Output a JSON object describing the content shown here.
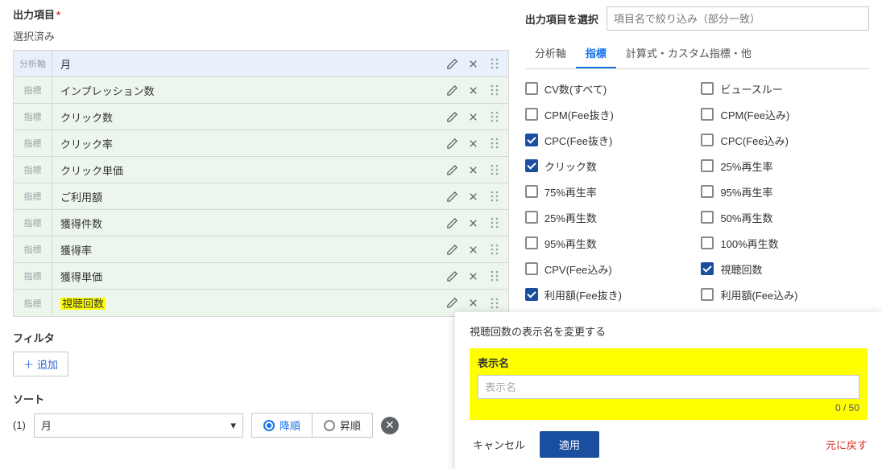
{
  "section_title": "出力項目",
  "selected_label": "選択済み",
  "axis_tag": "分析軸",
  "metric_tag": "指標",
  "rows": [
    {
      "tag": "分析軸",
      "label": "月",
      "type": "axis"
    },
    {
      "tag": "指標",
      "label": "インプレッション数",
      "type": "metric"
    },
    {
      "tag": "指標",
      "label": "クリック数",
      "type": "metric"
    },
    {
      "tag": "指標",
      "label": "クリック率",
      "type": "metric"
    },
    {
      "tag": "指標",
      "label": "クリック単価",
      "type": "metric"
    },
    {
      "tag": "指標",
      "label": "ご利用額",
      "type": "metric"
    },
    {
      "tag": "指標",
      "label": "獲得件数",
      "type": "metric"
    },
    {
      "tag": "指標",
      "label": "獲得率",
      "type": "metric"
    },
    {
      "tag": "指標",
      "label": "獲得単価",
      "type": "metric"
    },
    {
      "tag": "指標",
      "label": "視聴回数",
      "type": "metric",
      "highlight": true
    }
  ],
  "filter_title": "フィルタ",
  "add_label": "追加",
  "sort_title": "ソート",
  "sort_count": "(1)",
  "sort_field": "月",
  "sort_desc": "降順",
  "sort_asc": "昇順",
  "right_title": "出力項目を選択",
  "search_placeholder": "項目名で絞り込み（部分一致）",
  "tabs": {
    "axis": "分析軸",
    "metric": "指標",
    "custom": "計算式・カスタム指標・他"
  },
  "metrics_left": [
    {
      "label": "CV数(すべて)",
      "checked": false
    },
    {
      "label": "CPM(Fee抜き)",
      "checked": false
    },
    {
      "label": "CPC(Fee抜き)",
      "checked": true
    },
    {
      "label": "クリック数",
      "checked": true
    },
    {
      "label": "75%再生率",
      "checked": false
    },
    {
      "label": "25%再生数",
      "checked": false
    },
    {
      "label": "95%再生数",
      "checked": false
    },
    {
      "label": "CPV(Fee込み)",
      "checked": false
    },
    {
      "label": "利用額(Fee抜き)",
      "checked": true
    }
  ],
  "metrics_right": [
    {
      "label": "ビュースルー",
      "checked": false
    },
    {
      "label": "CPM(Fee込み)",
      "checked": false
    },
    {
      "label": "CPC(Fee込み)",
      "checked": false
    },
    {
      "label": "25%再生率",
      "checked": false
    },
    {
      "label": "95%再生率",
      "checked": false
    },
    {
      "label": "50%再生数",
      "checked": false
    },
    {
      "label": "100%再生数",
      "checked": false
    },
    {
      "label": "視聴回数",
      "checked": true
    },
    {
      "label": "利用額(Fee込み)",
      "checked": false
    }
  ],
  "modal": {
    "title": "視聴回数の表示名を変更する",
    "field_label": "表示名",
    "placeholder": "表示名",
    "counter": "0 / 50",
    "cancel": "キャンセル",
    "apply": "適用",
    "reset": "元に戻す"
  }
}
